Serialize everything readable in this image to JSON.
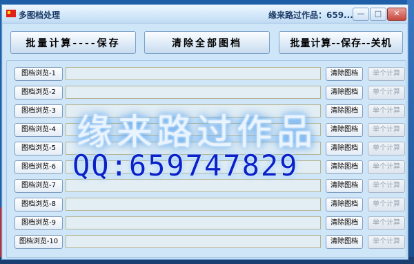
{
  "window": {
    "title": "多图档处理",
    "author_label": "缘来路过作品：659...",
    "controls": {
      "minimize": "—",
      "maximize": "□",
      "close": "✕"
    }
  },
  "toolbar": {
    "batch_save": "批量计算----保存",
    "clear_all": "清除全部图档",
    "batch_save_shutdown": "批量计算--保存--关机"
  },
  "rows": [
    {
      "browse": "图档浏览-1",
      "clear": "清除图档",
      "single": "单个计算"
    },
    {
      "browse": "图档浏览-2",
      "clear": "清除图档",
      "single": "单个计算"
    },
    {
      "browse": "图档浏览-3",
      "clear": "清除图档",
      "single": "单个计算"
    },
    {
      "browse": "图档浏览-4",
      "clear": "清除图档",
      "single": "单个计算"
    },
    {
      "browse": "图档浏览-5",
      "clear": "清除图档",
      "single": "单个计算"
    },
    {
      "browse": "图档浏览-6",
      "clear": "清除图档",
      "single": "单个计算"
    },
    {
      "browse": "图档浏览-7",
      "clear": "清除图档",
      "single": "单个计算"
    },
    {
      "browse": "图档浏览-8",
      "clear": "清除图档",
      "single": "单个计算"
    },
    {
      "browse": "图档浏览-9",
      "clear": "清除图档",
      "single": "单个计算"
    },
    {
      "browse": "图档浏览-10",
      "clear": "清除图档",
      "single": "单个计算"
    }
  ],
  "watermark": {
    "line1": "缘来路过作品",
    "line2": "QQ:659747829"
  }
}
